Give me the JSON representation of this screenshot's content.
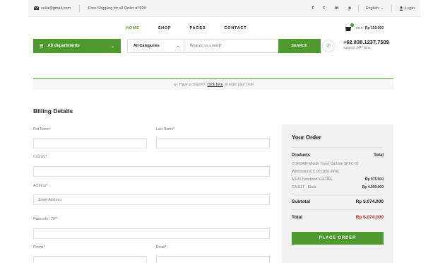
{
  "topbar": {
    "email": "sella@gmail.com",
    "shipping": "Free Shipping for all Order of $99",
    "social": [
      "f",
      "t",
      "in",
      "p"
    ],
    "language": "English",
    "login": "Login"
  },
  "nav": {
    "items": [
      "HOME",
      "SHOP",
      "PAGES",
      "CONTACT"
    ],
    "active": "HOME"
  },
  "cart": {
    "label": "item:",
    "price": "Rp 150.000"
  },
  "departments": {
    "label": "All departments"
  },
  "search": {
    "category": "All Categories",
    "placeholder": "What do yo u need?",
    "button": "SEARCH"
  },
  "phone": {
    "number": "+62 838.1237.7509",
    "support": "support 24/7 time"
  },
  "coupon": {
    "text": "Have a coupon?",
    "link": "Click here",
    "after": "to enter your code"
  },
  "billing": {
    "title": "Billing Details",
    "first_name": "Fist Name*",
    "last_name": "Last Name*",
    "country": "Country*",
    "address": "Address*",
    "street_placeholder": "Street Address",
    "postcode": "Postcode / ZIP*",
    "phone": "Phone*",
    "email": "Email*"
  },
  "order": {
    "title": "Your Order",
    "products_label": "Products",
    "total_label": "Total",
    "product1_line1": "CORSAIR Middle Tower Carbide SPEC-02",
    "product1_line2": "Windowed [CC-9011051-WW]",
    "product2_name": "ASUS Notebook X441MA-",
    "product2_price": "Rp 975.000",
    "product3_name": "GA011T - Black",
    "product3_price": "Rp 4.099.000",
    "subtotal_label": "Subtotal",
    "subtotal_value": "Rp 5.074.000",
    "grand_label": "Total",
    "grand_value": "Rp 5.074.000",
    "place_order": "PLACE ORDER"
  },
  "colors": {
    "accent": "#4e9a2c",
    "total_red": "#d61f1f"
  }
}
